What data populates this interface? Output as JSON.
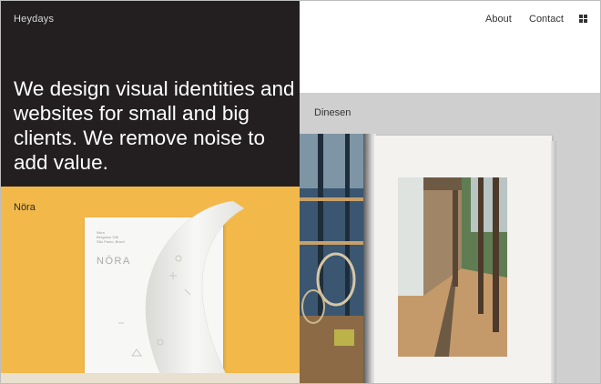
{
  "brand": {
    "name": "Heydays"
  },
  "intro": {
    "tagline": "We design visual identities and websites for small and big clients. We remove noise to add value."
  },
  "nav": {
    "about": "About",
    "contact": "Contact",
    "menu_icon": "grid-menu-icon"
  },
  "projects": [
    {
      "title": "Nöra"
    },
    {
      "title": "Dinesen"
    }
  ],
  "nora_card": {
    "address_lines": [
      "Nöra",
      "Bergamo 345",
      "São Paulo, Brazil"
    ],
    "logo": "NÖRA"
  },
  "colors": {
    "intro_bg": "#231f20",
    "nora_bg": "#f2b94a",
    "dinesen_bg": "#cfcfcf"
  }
}
